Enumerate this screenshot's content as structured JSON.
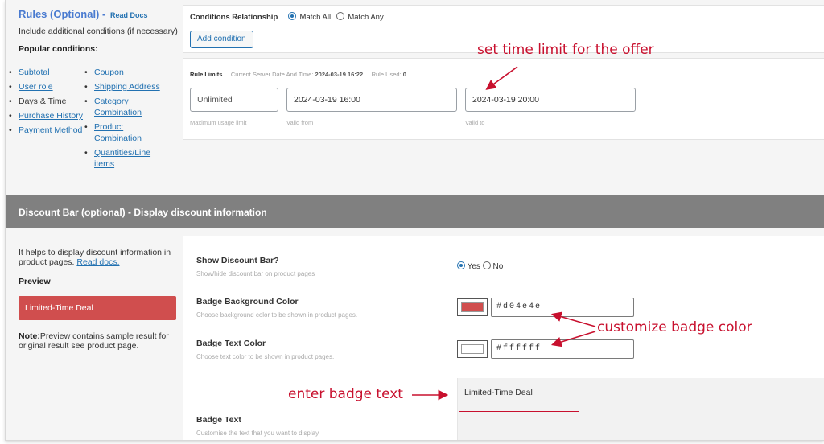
{
  "rules": {
    "title": "Rules (Optional)",
    "dash": "-",
    "read_docs": "Read Docs",
    "description": "Include additional conditions (if necessary)",
    "popular_label": "Popular conditions:",
    "conditions_col1": [
      {
        "label": "Subtotal",
        "link": true
      },
      {
        "label": "User role",
        "link": true
      },
      {
        "label": "Days & Time",
        "link": false
      },
      {
        "label": "Purchase History",
        "link": true
      },
      {
        "label": "Payment Method",
        "link": true
      }
    ],
    "conditions_col2": [
      {
        "label": "Coupon",
        "link": true
      },
      {
        "label": "Shipping Address",
        "link": true
      },
      {
        "label": "Category Combination",
        "link": true
      },
      {
        "label": "Product Combination",
        "link": true
      },
      {
        "label": "Quantities/Line items",
        "link": true
      }
    ],
    "conditions_relationship_label": "Conditions Relationship",
    "match_all_label": "Match All",
    "match_any_label": "Match Any",
    "match_selected": "all",
    "add_condition_label": "Add condition"
  },
  "rule_limits": {
    "label": "Rule Limits",
    "server_time_label": "Current Server Date And Time:",
    "server_time_value": "2024-03-19 16:22",
    "rule_used_label": "Rule Used:",
    "rule_used_value": "0",
    "usage_limit_value": "Unlimited",
    "usage_limit_caption": "Maximum usage limit",
    "valid_from_value": "2024-03-19 16:00",
    "valid_from_caption": "Vaild from",
    "valid_to_value": "2024-03-19 20:00",
    "valid_to_caption": "Vaild to"
  },
  "discount_bar": {
    "header": "Discount Bar (optional) - Display discount information",
    "help_text": "It helps to display discount information in product pages.",
    "read_docs": "Read docs.",
    "preview_label": "Preview",
    "preview_badge_text": "Limited-Time Deal",
    "note_label": "Note:",
    "note_text": "Preview contains sample result for original result see product page.",
    "show_label": "Show Discount Bar?",
    "show_desc": "Show/hide discount bar on product pages",
    "yes_label": "Yes",
    "no_label": "No",
    "show_selected": "yes",
    "bg_color_label": "Badge Background Color",
    "bg_color_desc": "Choose background color to be shown in product pages.",
    "bg_color_value": "#d04e4e",
    "text_color_label": "Badge Text Color",
    "text_color_desc": "Choose text color to be shown in product pages.",
    "text_color_value": "#ffffff",
    "badge_text_label": "Badge Text",
    "badge_text_desc": "Customise the text that you want to display.",
    "badge_text_value": "Limited-Time Deal"
  },
  "annotations": {
    "time_limit": "set time limit for the offer",
    "badge_color": "customize badge color",
    "badge_text": "enter badge text",
    "color": "#c8102e"
  },
  "colors": {
    "accent": "#2271b1",
    "title_blue": "#4a7bd0",
    "header_bg": "#808080",
    "badge_bg": "#d04e4e"
  }
}
